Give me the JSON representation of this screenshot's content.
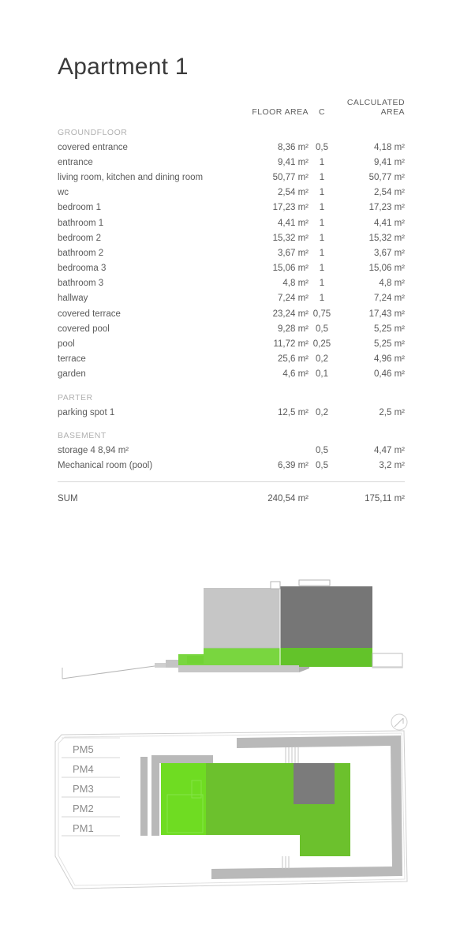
{
  "document": {
    "title": "Apartment 1"
  },
  "table": {
    "headers": {
      "name": "",
      "floor_area": "FLOOR AREA",
      "coefficient": "C",
      "calculated_area_line1": "CALCULATED",
      "calculated_area_line2": "AREA"
    },
    "sections": [
      {
        "label": "GROUNDFLOOR",
        "rows": [
          {
            "name": "covered entrance",
            "floor_area": "8,36 m²",
            "c": "0,5",
            "calculated": "4,18 m²"
          },
          {
            "name": "entrance",
            "floor_area": "9,41 m²",
            "c": "1",
            "calculated": "9,41 m²"
          },
          {
            "name": "living room, kitchen and dining room",
            "floor_area": "50,77 m²",
            "c": "1",
            "calculated": "50,77 m²"
          },
          {
            "name": "wc",
            "floor_area": "2,54 m²",
            "c": "1",
            "calculated": "2,54 m²"
          },
          {
            "name": "bedroom 1",
            "floor_area": "17,23 m²",
            "c": "1",
            "calculated": "17,23 m²"
          },
          {
            "name": "bathroom 1",
            "floor_area": "4,41 m²",
            "c": "1",
            "calculated": "4,41 m²"
          },
          {
            "name": "bedroom 2",
            "floor_area": "15,32 m²",
            "c": "1",
            "calculated": "15,32 m²"
          },
          {
            "name": "bathroom 2",
            "floor_area": "3,67 m²",
            "c": "1",
            "calculated": "3,67 m²"
          },
          {
            "name": "bedrooma 3",
            "floor_area": "15,06 m²",
            "c": "1",
            "calculated": "15,06 m²"
          },
          {
            "name": "bathroom 3",
            "floor_area": "4,8 m²",
            "c": "1",
            "calculated": "4,8 m²"
          },
          {
            "name": "hallway",
            "floor_area": "7,24 m²",
            "c": "1",
            "calculated": "7,24 m²"
          },
          {
            "name": "covered terrace",
            "floor_area": "23,24 m²",
            "c": "0,75",
            "calculated": "17,43 m²"
          },
          {
            "name": "covered pool",
            "floor_area": "9,28 m²",
            "c": "0,5",
            "calculated": "5,25 m²"
          },
          {
            "name": "pool",
            "floor_area": "11,72 m²",
            "c": "0,25",
            "calculated": "5,25 m²"
          },
          {
            "name": "terrace",
            "floor_area": "25,6 m²",
            "c": "0,2",
            "calculated": "4,96 m²"
          },
          {
            "name": "garden",
            "floor_area": "4,6 m²",
            "c": "0,1",
            "calculated": "0,46 m²"
          }
        ]
      },
      {
        "label": "PARTER",
        "rows": [
          {
            "name": "parking spot  1",
            "floor_area": "12,5 m²",
            "c": "0,2",
            "calculated": "2,5 m²"
          }
        ]
      },
      {
        "label": "BASEMENT",
        "rows": [
          {
            "name": "storage 4   8,94 m²",
            "floor_area": "",
            "c": "0,5",
            "calculated": "4,47 m²"
          },
          {
            "name": "Mechanical room (pool)",
            "floor_area": "6,39 m²",
            "c": "0,5",
            "calculated": "3,2 m²"
          }
        ]
      }
    ],
    "sum": {
      "label": "SUM",
      "floor_area": "240,54 m²",
      "c": "",
      "calculated": "175,11 m²"
    }
  },
  "elevation": {
    "name": "building-section-elevation",
    "colors": {
      "light_gray": "#c6c6c6",
      "dark_gray": "#767676",
      "light_green": "#79d63f",
      "dark_green": "#63c32a",
      "outline": "#b8b8b8"
    }
  },
  "siteplan": {
    "name": "ground-floor-site-plan",
    "parking_labels": [
      "PM5",
      "PM4",
      "PM3",
      "PM2",
      "PM1"
    ],
    "north_icon": "compass-north-icon",
    "colors": {
      "wall_gray": "#b9b9b9",
      "dark_gray": "#7b7b7b",
      "light_green": "#6fdc22",
      "dark_green": "#6cc12d",
      "outline": "#cfcfcf"
    }
  }
}
